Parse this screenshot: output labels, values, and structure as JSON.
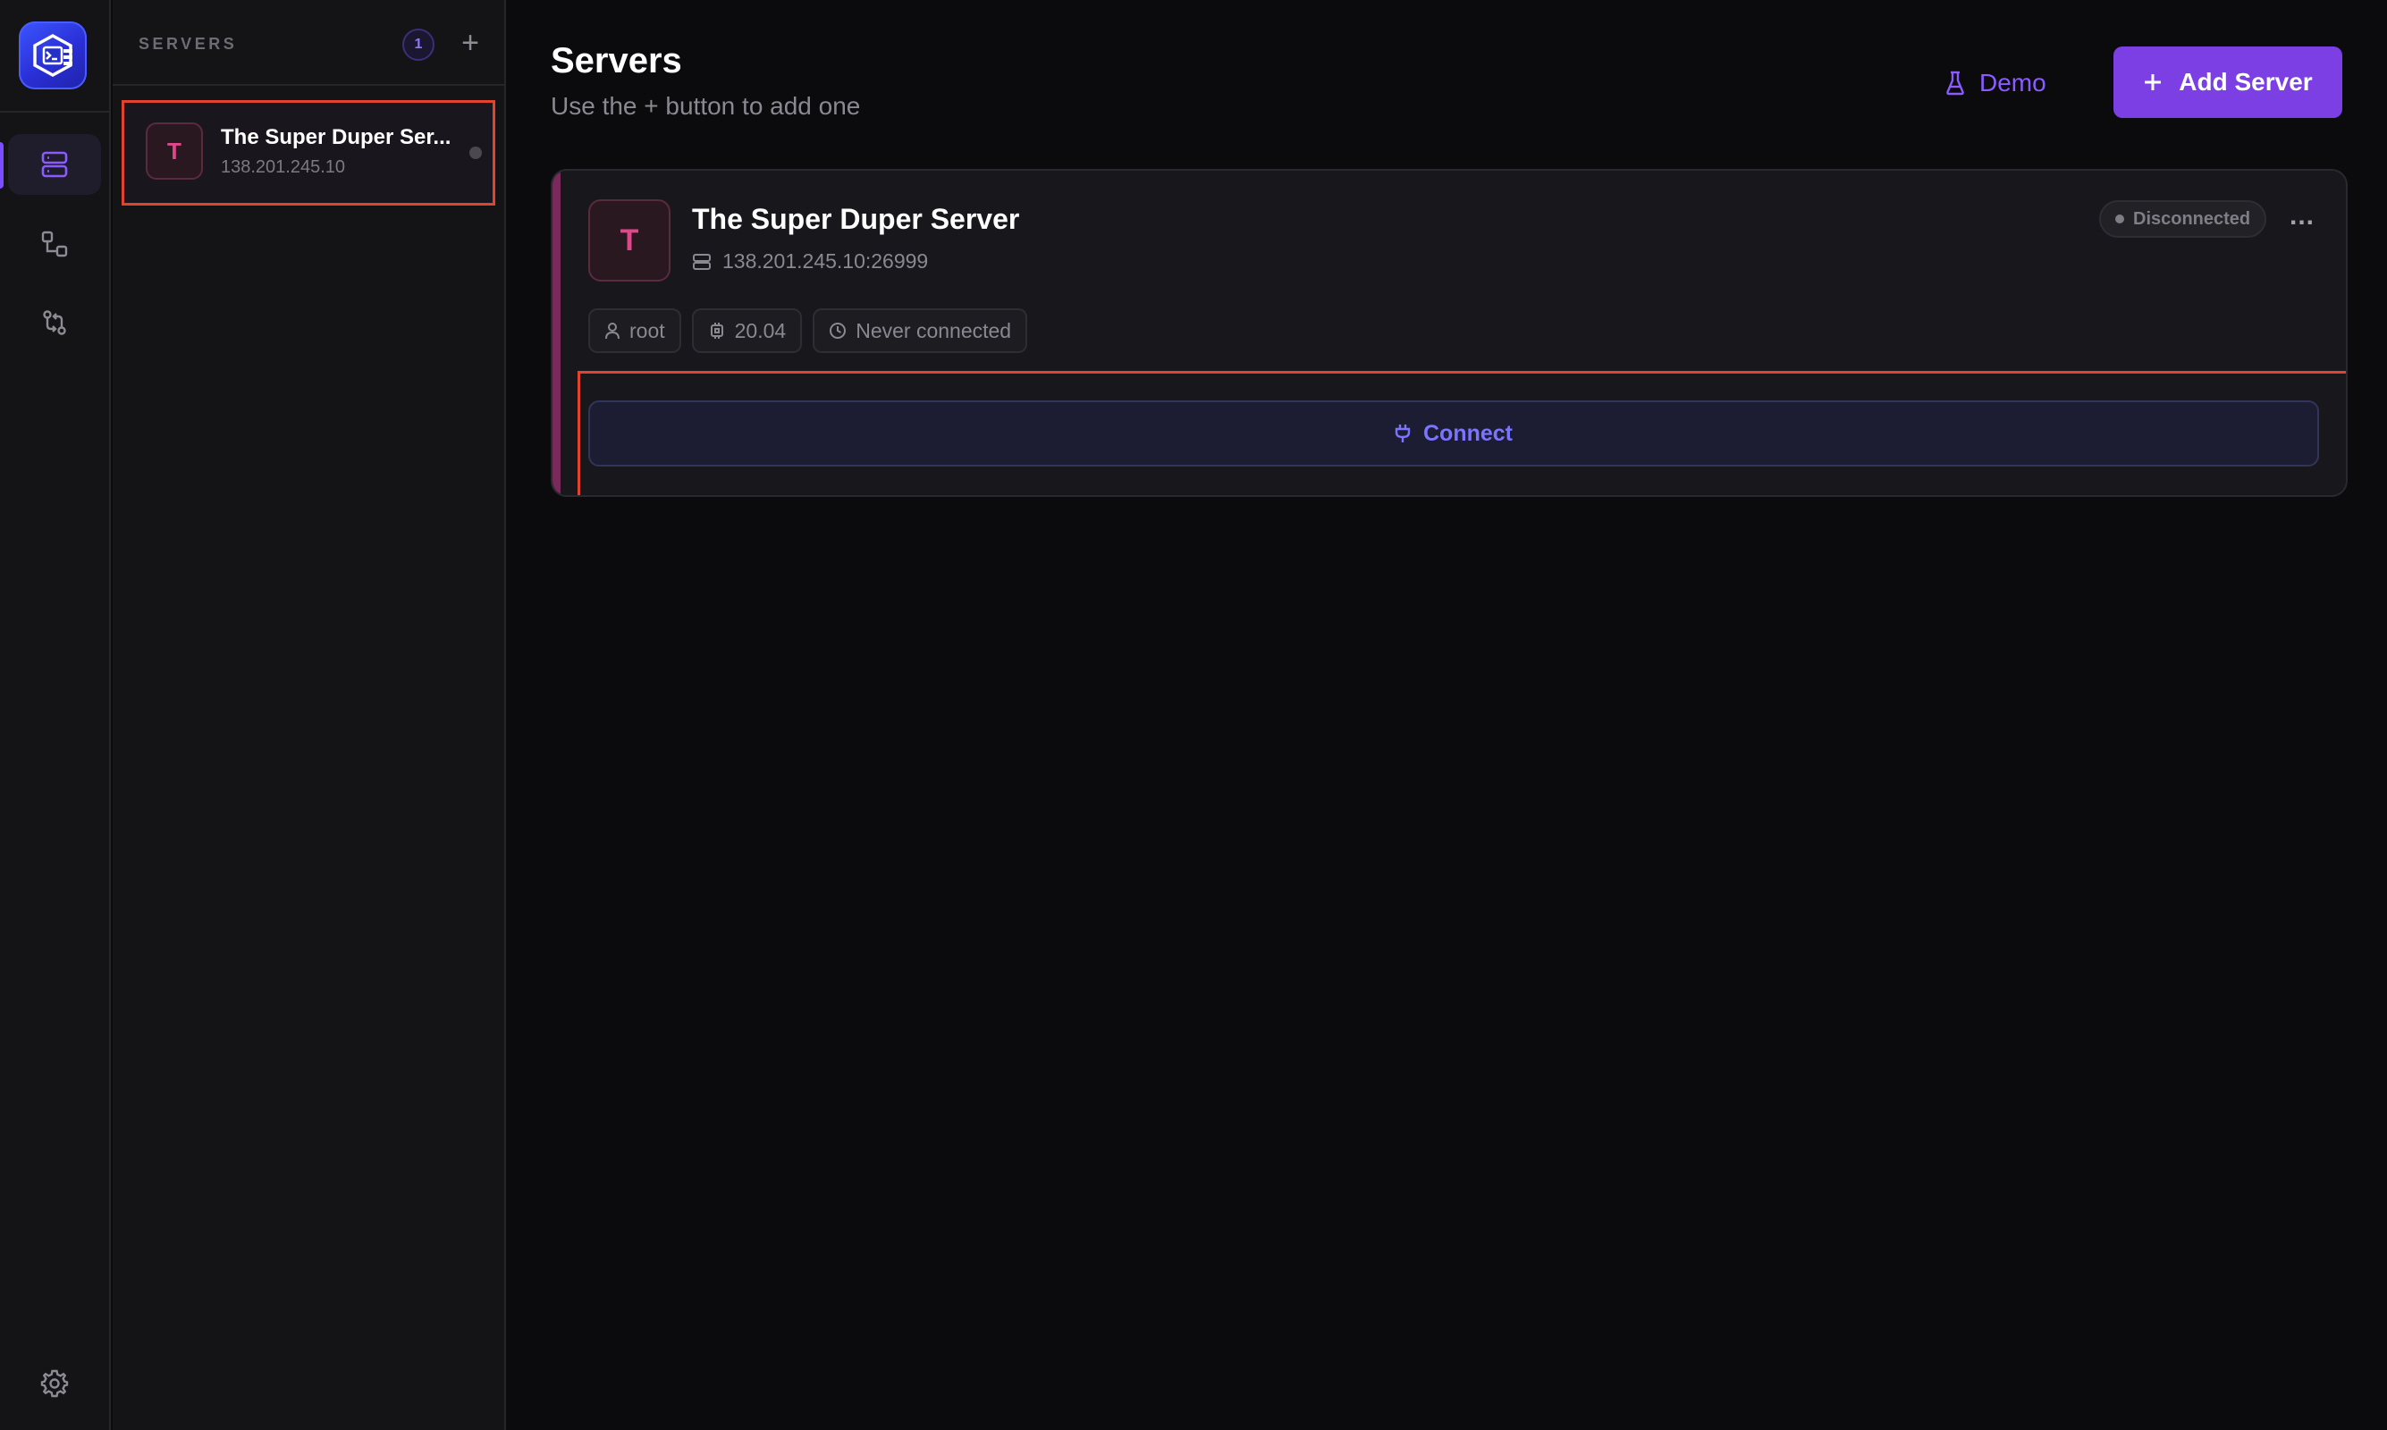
{
  "rail": {
    "items": [
      {
        "name": "servers",
        "icon": "server-stack-icon",
        "active": true
      },
      {
        "name": "connections",
        "icon": "connection-nodes-icon",
        "active": false
      },
      {
        "name": "transfers",
        "icon": "transfer-icon",
        "active": false
      }
    ],
    "settings_icon": "gear-icon"
  },
  "sidebar": {
    "title": "SERVERS",
    "count": "1",
    "add_label": "+",
    "items": [
      {
        "initial": "T",
        "name": "The Super Duper Ser...",
        "ip": "138.201.245.10"
      }
    ]
  },
  "main": {
    "title": "Servers",
    "subtitle": "Use the + button to add one",
    "demo_label": "Demo",
    "add_server_label": "Add Server",
    "card": {
      "initial": "T",
      "name": "The Super Duper Server",
      "host": "138.201.245.10:26999",
      "status": "Disconnected",
      "more": "...",
      "chips": {
        "user": "root",
        "version": "20.04",
        "last_connected": "Never connected"
      },
      "connect_label": "Connect"
    }
  },
  "colors": {
    "accent": "#7b3fe4",
    "highlight": "#e2432f",
    "avatar_text": "#e0468a",
    "connect_text": "#7a74ff"
  }
}
